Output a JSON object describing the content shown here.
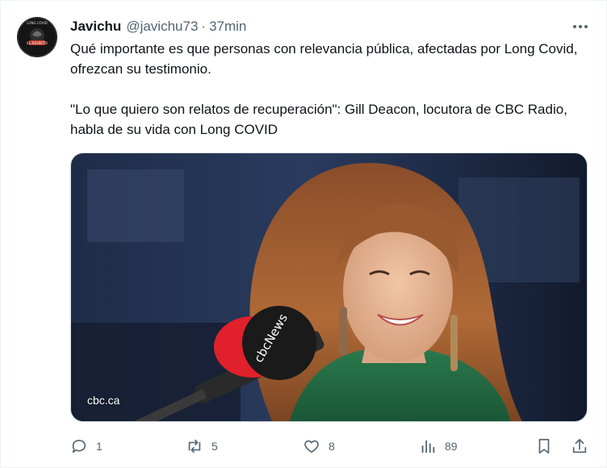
{
  "tweet": {
    "author_name": "Javichu",
    "handle": "@javichu73",
    "separator": "·",
    "time": "37min",
    "text_paragraphs": [
      "Qué importante es que personas con relevancia pública, afectadas por Long Covid, ofrezcan su testimonio.",
      "\"Lo que quiero son relatos de recuperación\": Gill Deacon, locutora de CBC Radio, habla de su vida con Long COVID"
    ],
    "avatar_text": [
      "LONG COVID",
      "EL RESPETO"
    ],
    "media": {
      "source_label": "cbc.ca",
      "mic_brand": "cbcNews"
    },
    "actions": {
      "reply": {
        "icon": "reply-icon",
        "count": "1"
      },
      "retweet": {
        "icon": "retweet-icon",
        "count": "5"
      },
      "like": {
        "icon": "heart-icon",
        "count": "8"
      },
      "views": {
        "icon": "views-icon",
        "count": "89"
      },
      "bookmark": {
        "icon": "bookmark-icon"
      },
      "share": {
        "icon": "share-icon"
      }
    }
  },
  "colors": {
    "text": "#0f1419",
    "secondary": "#536471",
    "border": "#eff3f4"
  }
}
